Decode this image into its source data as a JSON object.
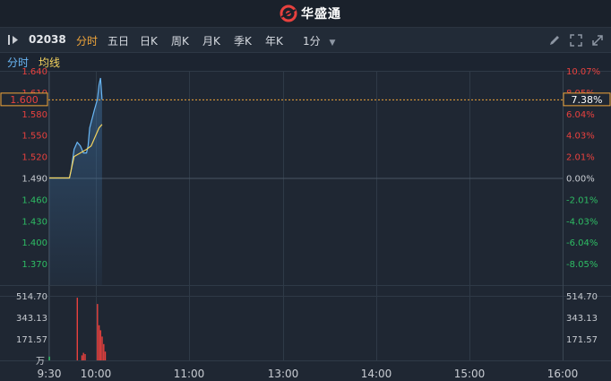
{
  "brand": {
    "name": "华盛通",
    "logo_icon": "huasheng-logo-icon"
  },
  "toolbar": {
    "stock_code": "02038",
    "tabs": [
      "分时",
      "五日",
      "日K",
      "周K",
      "月K",
      "季K",
      "年K"
    ],
    "active_tab": "分时",
    "interval": "1分",
    "icons": [
      "pencil-icon",
      "fullscreen-icon",
      "expand-icon"
    ]
  },
  "subbar": {
    "intraday_label": "分时",
    "avg_label": "均线"
  },
  "colors": {
    "up": "#e8413e",
    "down": "#2ebd64",
    "neutral": "#c8ccd2",
    "price_line": "#6ab7f5",
    "avg_line": "#f4d35e",
    "accent": "#f0a53a"
  },
  "chart_data": {
    "type": "line",
    "base_price": 1.49,
    "price_axis": {
      "left_labels": [
        "1.640",
        "1.610",
        "1.580",
        "1.550",
        "1.520",
        "1.490",
        "1.460",
        "1.430",
        "1.400",
        "1.370"
      ],
      "right_labels": [
        "10.07%",
        "8.05%",
        "6.04%",
        "4.03%",
        "2.01%",
        "0.00%",
        "-2.01%",
        "-4.03%",
        "-6.04%",
        "-8.05%"
      ],
      "ylim": [
        1.34,
        1.64
      ]
    },
    "crosshair": {
      "price": "1.600",
      "percent": "7.38%"
    },
    "volume_axis": {
      "labels": [
        "514.70",
        "343.13",
        "171.57"
      ],
      "unit": "万",
      "ylim": [
        0,
        514.7
      ]
    },
    "time_axis": {
      "labels": [
        "9:30",
        "10:00",
        "11:00",
        "13:00",
        "14:00",
        "15:00",
        "16:00"
      ]
    },
    "series": [
      {
        "name": "分时",
        "minutes": [
          0,
          13,
          14,
          16,
          18,
          20,
          21,
          22,
          24,
          25,
          26,
          29,
          31,
          32,
          33,
          34
        ],
        "values": [
          1.49,
          1.49,
          1.5,
          1.53,
          1.54,
          1.535,
          1.53,
          1.525,
          1.525,
          1.535,
          1.56,
          1.585,
          1.6,
          1.62,
          1.63,
          1.6
        ]
      },
      {
        "name": "均线",
        "minutes": [
          0,
          13,
          16,
          20,
          24,
          27,
          30,
          32,
          34
        ],
        "values": [
          1.49,
          1.49,
          1.52,
          1.525,
          1.53,
          1.535,
          1.55,
          1.56,
          1.565
        ]
      }
    ],
    "volume": {
      "minutes": [
        0,
        18,
        21,
        22,
        23,
        31,
        32,
        33,
        34,
        35,
        36
      ],
      "values": [
        30,
        500,
        40,
        60,
        50,
        450,
        280,
        240,
        190,
        130,
        70
      ],
      "colors": [
        "#2ebd64",
        "#e8413e",
        "#e8413e",
        "#e8413e",
        "#e8413e",
        "#e8413e",
        "#e8413e",
        "#e8413e",
        "#e8413e",
        "#e8413e",
        "#e8413e"
      ]
    }
  }
}
